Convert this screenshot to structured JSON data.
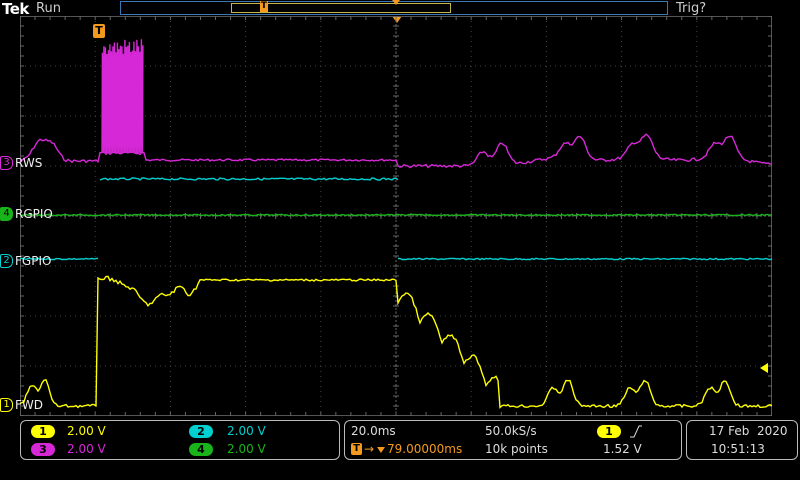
{
  "header": {
    "logo": "Tek",
    "run_state": "Run",
    "trigger_status": "Trig?",
    "overview_trigger_marker": "T"
  },
  "channels": [
    {
      "id": "1",
      "label": "FWD",
      "color": "#ffff00",
      "scale": "2.00 V"
    },
    {
      "id": "2",
      "label": "FGPIO",
      "color": "#00d0d0",
      "scale": "2.00 V"
    },
    {
      "id": "3",
      "label": "RWS",
      "color": "#d628d6",
      "scale": "2.00 V"
    },
    {
      "id": "4",
      "label": "RGPIO",
      "color": "#19b419",
      "scale": "2.00 V"
    }
  ],
  "trigger": {
    "marker": "T",
    "delay": "79.00000ms",
    "source": "1",
    "slope_icon": "rising-edge-icon",
    "level": "1.52 V"
  },
  "horizontal": {
    "time_per_div": "20.0ms",
    "sample_rate": "50.0kS/s",
    "record_length": "10k points"
  },
  "datetime": {
    "date": "17 Feb  2020",
    "time": "10:51:13"
  },
  "chart_data": {
    "type": "line",
    "grid": true,
    "divisions": {
      "x": 10,
      "y": 8
    },
    "series": [
      {
        "name": "RWS",
        "color": "#d628d6"
      },
      {
        "name": "FGPIO",
        "color": "#00d0d0"
      },
      {
        "name": "RGPIO",
        "color": "#19b419"
      },
      {
        "name": "FWD",
        "color": "#ffff00"
      }
    ]
  }
}
